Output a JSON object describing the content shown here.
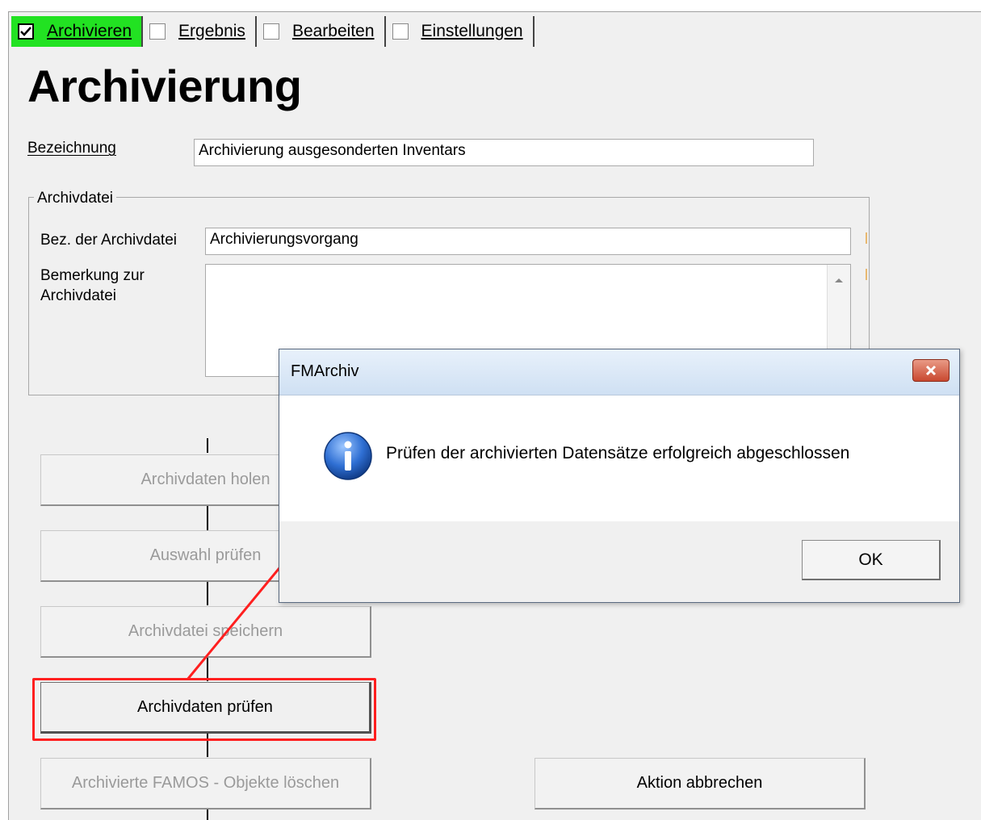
{
  "tabs": [
    {
      "label": "Archivieren",
      "checked": true
    },
    {
      "label": "Ergebnis",
      "checked": false
    },
    {
      "label": "Bearbeiten",
      "checked": false
    },
    {
      "label": "Einstellungen",
      "checked": false
    }
  ],
  "page_title": "Archivierung",
  "bezeichnung": {
    "label": "Bezeichnung",
    "value": "Archivierung ausgesonderten Inventars"
  },
  "archivdatei": {
    "group_label": "Archivdatei",
    "bez_label": "Bez. der Archivdatei",
    "bez_value": "Archivierungsvorgang",
    "bemerkung_label_line1": "Bemerkung zur",
    "bemerkung_label_line2": "Archivdatei",
    "bemerkung_value": ""
  },
  "buttons": {
    "archivdaten_holen": "Archivdaten holen",
    "auswahl_pruefen": "Auswahl prüfen",
    "archivdatei_speichern": "Archivdatei speichern",
    "archivdaten_pruefen": "Archivdaten prüfen",
    "objekte_loeschen": "Archivierte FAMOS - Objekte löschen",
    "aktion_abbrechen": "Aktion abbrechen"
  },
  "dialog": {
    "title": "FMArchiv",
    "message": "Prüfen der archivierten Datensätze erfolgreich abgeschlossen",
    "ok_label": "OK"
  },
  "colors": {
    "active_tab": "#22e222",
    "highlight": "#ff1f1f",
    "arrow": "#ff1f1f"
  }
}
